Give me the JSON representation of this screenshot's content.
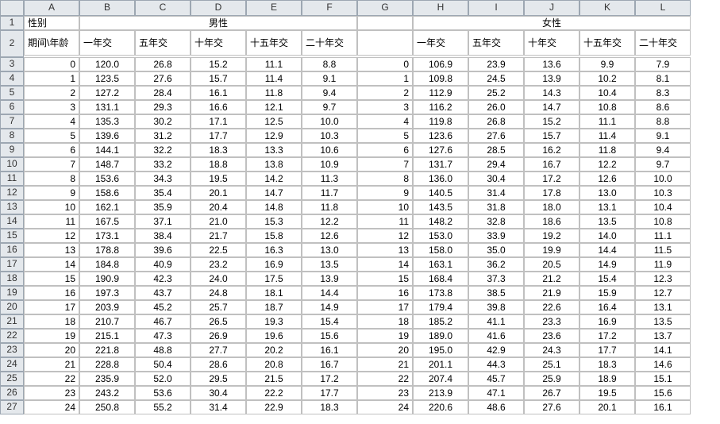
{
  "columns": [
    "",
    "A",
    "B",
    "C",
    "D",
    "E",
    "F",
    "G",
    "H",
    "I",
    "J",
    "K",
    "L"
  ],
  "row1": {
    "A": "性别",
    "male_title": "男性",
    "G": "",
    "female_title": "女性"
  },
  "row2": {
    "A": "期间\\年龄",
    "B": "一年交",
    "C": "五年交",
    "D": "十年交",
    "E": "十五年交",
    "F": "二十年交",
    "G": "",
    "H": "一年交",
    "I": "五年交",
    "J": "十年交",
    "K": "十五年交",
    "L": "二十年交"
  },
  "chart_data": {
    "type": "table",
    "title": "",
    "rows": [
      {
        "n": 3,
        "a": "0",
        "b": "120.0",
        "c": "26.8",
        "d": "15.2",
        "e": "11.1",
        "f": "8.8",
        "g": "0",
        "h": "106.9",
        "i": "23.9",
        "j": "13.6",
        "k": "9.9",
        "l": "7.9"
      },
      {
        "n": 4,
        "a": "1",
        "b": "123.5",
        "c": "27.6",
        "d": "15.7",
        "e": "11.4",
        "f": "9.1",
        "g": "1",
        "h": "109.8",
        "i": "24.5",
        "j": "13.9",
        "k": "10.2",
        "l": "8.1"
      },
      {
        "n": 5,
        "a": "2",
        "b": "127.2",
        "c": "28.4",
        "d": "16.1",
        "e": "11.8",
        "f": "9.4",
        "g": "2",
        "h": "112.9",
        "i": "25.2",
        "j": "14.3",
        "k": "10.4",
        "l": "8.3"
      },
      {
        "n": 6,
        "a": "3",
        "b": "131.1",
        "c": "29.3",
        "d": "16.6",
        "e": "12.1",
        "f": "9.7",
        "g": "3",
        "h": "116.2",
        "i": "26.0",
        "j": "14.7",
        "k": "10.8",
        "l": "8.6"
      },
      {
        "n": 7,
        "a": "4",
        "b": "135.3",
        "c": "30.2",
        "d": "17.1",
        "e": "12.5",
        "f": "10.0",
        "g": "4",
        "h": "119.8",
        "i": "26.8",
        "j": "15.2",
        "k": "11.1",
        "l": "8.8"
      },
      {
        "n": 8,
        "a": "5",
        "b": "139.6",
        "c": "31.2",
        "d": "17.7",
        "e": "12.9",
        "f": "10.3",
        "g": "5",
        "h": "123.6",
        "i": "27.6",
        "j": "15.7",
        "k": "11.4",
        "l": "9.1"
      },
      {
        "n": 9,
        "a": "6",
        "b": "144.1",
        "c": "32.2",
        "d": "18.3",
        "e": "13.3",
        "f": "10.6",
        "g": "6",
        "h": "127.6",
        "i": "28.5",
        "j": "16.2",
        "k": "11.8",
        "l": "9.4"
      },
      {
        "n": 10,
        "a": "7",
        "b": "148.7",
        "c": "33.2",
        "d": "18.8",
        "e": "13.8",
        "f": "10.9",
        "g": "7",
        "h": "131.7",
        "i": "29.4",
        "j": "16.7",
        "k": "12.2",
        "l": "9.7"
      },
      {
        "n": 11,
        "a": "8",
        "b": "153.6",
        "c": "34.3",
        "d": "19.5",
        "e": "14.2",
        "f": "11.3",
        "g": "8",
        "h": "136.0",
        "i": "30.4",
        "j": "17.2",
        "k": "12.6",
        "l": "10.0"
      },
      {
        "n": 12,
        "a": "9",
        "b": "158.6",
        "c": "35.4",
        "d": "20.1",
        "e": "14.7",
        "f": "11.7",
        "g": "9",
        "h": "140.5",
        "i": "31.4",
        "j": "17.8",
        "k": "13.0",
        "l": "10.3"
      },
      {
        "n": 13,
        "a": "10",
        "b": "162.1",
        "c": "35.9",
        "d": "20.4",
        "e": "14.8",
        "f": "11.8",
        "g": "10",
        "h": "143.5",
        "i": "31.8",
        "j": "18.0",
        "k": "13.1",
        "l": "10.4"
      },
      {
        "n": 14,
        "a": "11",
        "b": "167.5",
        "c": "37.1",
        "d": "21.0",
        "e": "15.3",
        "f": "12.2",
        "g": "11",
        "h": "148.2",
        "i": "32.8",
        "j": "18.6",
        "k": "13.5",
        "l": "10.8"
      },
      {
        "n": 15,
        "a": "12",
        "b": "173.1",
        "c": "38.4",
        "d": "21.7",
        "e": "15.8",
        "f": "12.6",
        "g": "12",
        "h": "153.0",
        "i": "33.9",
        "j": "19.2",
        "k": "14.0",
        "l": "11.1"
      },
      {
        "n": 16,
        "a": "13",
        "b": "178.8",
        "c": "39.6",
        "d": "22.5",
        "e": "16.3",
        "f": "13.0",
        "g": "13",
        "h": "158.0",
        "i": "35.0",
        "j": "19.9",
        "k": "14.4",
        "l": "11.5"
      },
      {
        "n": 17,
        "a": "14",
        "b": "184.8",
        "c": "40.9",
        "d": "23.2",
        "e": "16.9",
        "f": "13.5",
        "g": "14",
        "h": "163.1",
        "i": "36.2",
        "j": "20.5",
        "k": "14.9",
        "l": "11.9"
      },
      {
        "n": 18,
        "a": "15",
        "b": "190.9",
        "c": "42.3",
        "d": "24.0",
        "e": "17.5",
        "f": "13.9",
        "g": "15",
        "h": "168.4",
        "i": "37.3",
        "j": "21.2",
        "k": "15.4",
        "l": "12.3"
      },
      {
        "n": 19,
        "a": "16",
        "b": "197.3",
        "c": "43.7",
        "d": "24.8",
        "e": "18.1",
        "f": "14.4",
        "g": "16",
        "h": "173.8",
        "i": "38.5",
        "j": "21.9",
        "k": "15.9",
        "l": "12.7"
      },
      {
        "n": 20,
        "a": "17",
        "b": "203.9",
        "c": "45.2",
        "d": "25.7",
        "e": "18.7",
        "f": "14.9",
        "g": "17",
        "h": "179.4",
        "i": "39.8",
        "j": "22.6",
        "k": "16.4",
        "l": "13.1"
      },
      {
        "n": 21,
        "a": "18",
        "b": "210.7",
        "c": "46.7",
        "d": "26.5",
        "e": "19.3",
        "f": "15.4",
        "g": "18",
        "h": "185.2",
        "i": "41.1",
        "j": "23.3",
        "k": "16.9",
        "l": "13.5"
      },
      {
        "n": 22,
        "a": "19",
        "b": "215.1",
        "c": "47.3",
        "d": "26.9",
        "e": "19.6",
        "f": "15.6",
        "g": "19",
        "h": "189.0",
        "i": "41.6",
        "j": "23.6",
        "k": "17.2",
        "l": "13.7"
      },
      {
        "n": 23,
        "a": "20",
        "b": "221.8",
        "c": "48.8",
        "d": "27.7",
        "e": "20.2",
        "f": "16.1",
        "g": "20",
        "h": "195.0",
        "i": "42.9",
        "j": "24.3",
        "k": "17.7",
        "l": "14.1"
      },
      {
        "n": 24,
        "a": "21",
        "b": "228.8",
        "c": "50.4",
        "d": "28.6",
        "e": "20.8",
        "f": "16.7",
        "g": "21",
        "h": "201.1",
        "i": "44.3",
        "j": "25.1",
        "k": "18.3",
        "l": "14.6"
      },
      {
        "n": 25,
        "a": "22",
        "b": "235.9",
        "c": "52.0",
        "d": "29.5",
        "e": "21.5",
        "f": "17.2",
        "g": "22",
        "h": "207.4",
        "i": "45.7",
        "j": "25.9",
        "k": "18.9",
        "l": "15.1"
      },
      {
        "n": 26,
        "a": "23",
        "b": "243.2",
        "c": "53.6",
        "d": "30.4",
        "e": "22.2",
        "f": "17.7",
        "g": "23",
        "h": "213.9",
        "i": "47.1",
        "j": "26.7",
        "k": "19.5",
        "l": "15.6"
      },
      {
        "n": 27,
        "a": "24",
        "b": "250.8",
        "c": "55.2",
        "d": "31.4",
        "e": "22.9",
        "f": "18.3",
        "g": "24",
        "h": "220.6",
        "i": "48.6",
        "j": "27.6",
        "k": "20.1",
        "l": "16.1"
      }
    ]
  }
}
